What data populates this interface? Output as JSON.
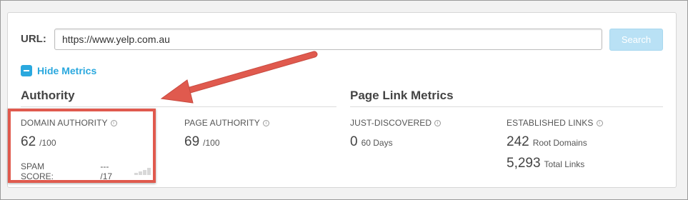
{
  "url_bar": {
    "label": "URL:",
    "value": "https://www.yelp.com.au",
    "search_label": "Search"
  },
  "toggle": {
    "label": "Hide Metrics",
    "icon": "minus-square-icon"
  },
  "authority": {
    "title": "Authority",
    "domain_authority": {
      "label": "DOMAIN AUTHORITY",
      "value": "62",
      "max": "/100"
    },
    "page_authority": {
      "label": "PAGE AUTHORITY",
      "value": "69",
      "max": "/100"
    },
    "spam_score": {
      "label": "SPAM SCORE:",
      "value": "--- /17"
    }
  },
  "page_link_metrics": {
    "title": "Page Link Metrics",
    "just_discovered": {
      "label": "JUST-DISCOVERED",
      "value": "0",
      "unit": "60 Days"
    },
    "established_links": {
      "label": "ESTABLISHED LINKS",
      "root_domains_value": "242",
      "root_domains_unit": "Root Domains",
      "total_links_value": "5,293",
      "total_links_unit": "Total Links"
    }
  },
  "colors": {
    "accent": "#2aa8de",
    "annotation": "#e05a4e",
    "search_button": "#b9e1f5"
  }
}
